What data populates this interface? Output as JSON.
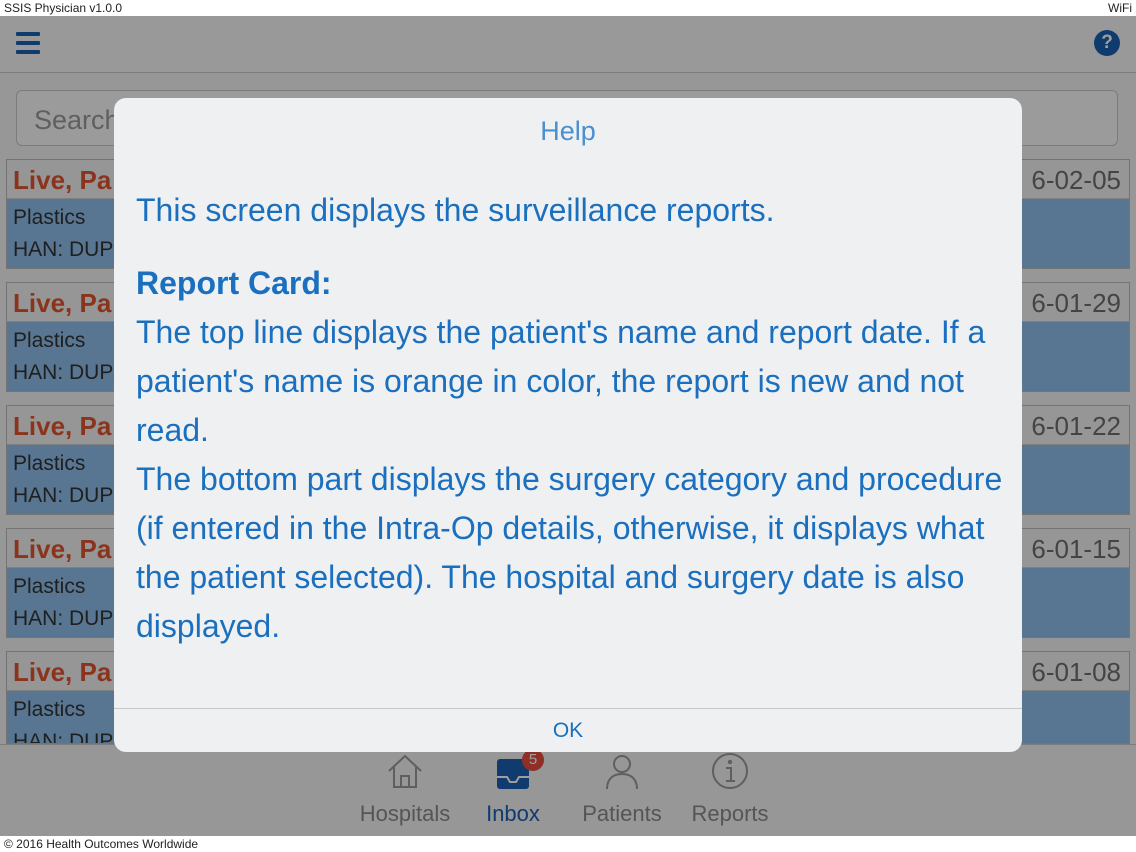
{
  "status_bar": {
    "app_version": "SSIS Physician v1.0.0",
    "network": "WiFi"
  },
  "header": {
    "help_symbol": "?"
  },
  "search": {
    "placeholder": "Search"
  },
  "cards": [
    {
      "name": "Live, Pa",
      "date": "6-02-05",
      "category": "Plastics",
      "han": "HAN: DUP"
    },
    {
      "name": "Live, Pa",
      "date": "6-01-29",
      "category": "Plastics",
      "han": "HAN: DUP"
    },
    {
      "name": "Live, Pa",
      "date": "6-01-22",
      "category": "Plastics",
      "han": "HAN: DUP"
    },
    {
      "name": "Live, Pa",
      "date": "6-01-15",
      "category": "Plastics",
      "han": "HAN: DUP"
    },
    {
      "name": "Live, Pa",
      "date": "6-01-08",
      "category": "Plastics",
      "han": "HAN: DUP"
    }
  ],
  "tabs": [
    {
      "label": "Hospitals",
      "icon": "home-icon"
    },
    {
      "label": "Inbox",
      "icon": "inbox-icon",
      "badge": "5"
    },
    {
      "label": "Patients",
      "icon": "person-icon"
    },
    {
      "label": "Reports",
      "icon": "info-icon"
    }
  ],
  "dialog": {
    "title": "Help",
    "intro": "This screen displays the surveillance reports.",
    "section_heading": "Report Card:",
    "paragraph1": "The top line displays the patient's name and report date. If a patient's name is orange in color, the report is new and not read.",
    "paragraph2": "The bottom part displays the surgery category and procedure (if entered in the Intra-Op details, otherwise, it displays what the patient selected). The hospital and surgery date is also displayed.",
    "ok_label": "OK"
  },
  "footer": {
    "copyright": "© 2016 Health Outcomes Worldwide"
  },
  "colors": {
    "accent": "#1a5fb4",
    "new_report_name": "#e0552f",
    "card_body": "#8fbfea",
    "dialog_text": "#1a6fbf"
  }
}
